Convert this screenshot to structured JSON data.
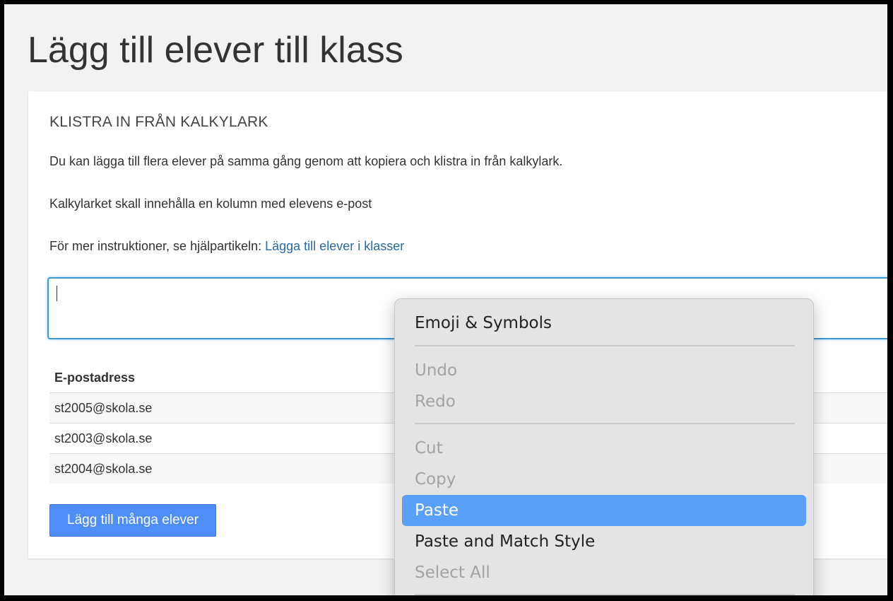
{
  "page": {
    "title": "Lägg till elever till klass"
  },
  "panel": {
    "heading": "KLISTRA IN FRÅN KALKYLARK",
    "paragraph1": "Du kan lägga till flera elever på samma gång genom att kopiera och klistra in från kalkylark.",
    "paragraph2": "Kalkylarket skall innehålla en kolumn med elevens e-post",
    "paragraph3_prefix": "För mer instruktioner, se hjälpartikeln: ",
    "help_link": "Lägga till elever i klasser",
    "input_value": "",
    "table": {
      "header": "E-postadress",
      "rows": [
        "st2005@skola.se",
        "st2003@skola.se",
        "st2004@skola.se"
      ]
    },
    "add_button": "Lägg till många elever"
  },
  "context_menu": {
    "items": [
      {
        "label": "Emoji & Symbols",
        "enabled": true
      },
      {
        "label": "Undo",
        "enabled": false
      },
      {
        "label": "Redo",
        "enabled": false
      },
      {
        "label": "Cut",
        "enabled": false
      },
      {
        "label": "Copy",
        "enabled": false
      },
      {
        "label": "Paste",
        "enabled": true,
        "highlighted": true
      },
      {
        "label": "Paste and Match Style",
        "enabled": true
      },
      {
        "label": "Select All",
        "enabled": false
      }
    ]
  },
  "colors": {
    "accent": "#4f8ef7",
    "link": "#2b6a9e",
    "input_focus": "#3a9ad9",
    "menu_highlight": "#5aa0f8"
  }
}
